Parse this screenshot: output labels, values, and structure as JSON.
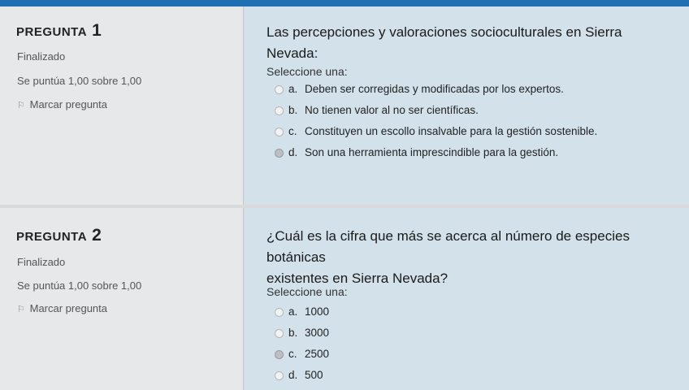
{
  "questions": [
    {
      "label": "PREGUNTA",
      "number": "1",
      "state": "Finalizado",
      "grade": "Se puntúa 1,00 sobre 1,00",
      "flag_label": "Marcar pregunta",
      "text": "Las percepciones y valoraciones socioculturales en Sierra Nevada:",
      "prompt": "Seleccione una:",
      "options": [
        {
          "letter": "a.",
          "text": "Deben ser corregidas y modificadas por los expertos.",
          "selected": false
        },
        {
          "letter": "b.",
          "text": "No tienen valor al no ser científicas.",
          "selected": false
        },
        {
          "letter": "c.",
          "text": "Constituyen un escollo insalvable para la gestión sostenible.",
          "selected": false
        },
        {
          "letter": "d.",
          "text": "Son una herramienta imprescindible para la gestión.",
          "selected": true
        }
      ]
    },
    {
      "label": "PREGUNTA",
      "number": "2",
      "state": "Finalizado",
      "grade": "Se puntúa 1,00 sobre 1,00",
      "flag_label": "Marcar pregunta",
      "text_line1": "¿Cuál es la cifra que más se acerca al número de especies botánicas",
      "text_line2": "existentes en Sierra Nevada?",
      "prompt": "Seleccione una:",
      "options": [
        {
          "letter": "a.",
          "text": "1000",
          "selected": false
        },
        {
          "letter": "b.",
          "text": "3000",
          "selected": false
        },
        {
          "letter": "c.",
          "text": "2500",
          "selected": true
        },
        {
          "letter": "d.",
          "text": "500",
          "selected": false
        }
      ]
    }
  ],
  "colors": {
    "accent": "#1f6fb2",
    "content_bg": "#d3e1ea",
    "info_bg": "#e7e8e9"
  }
}
